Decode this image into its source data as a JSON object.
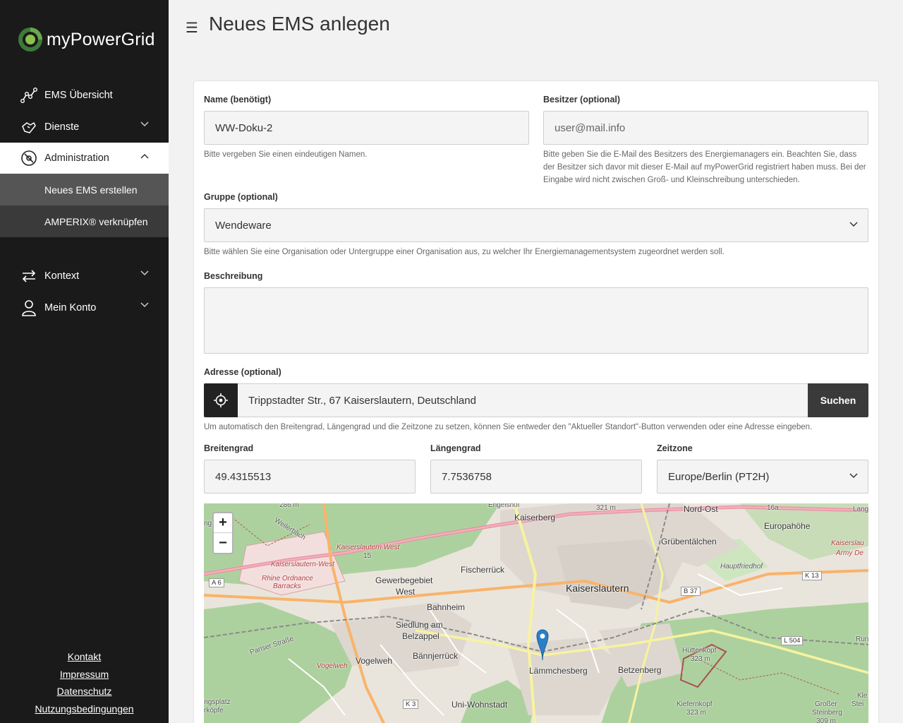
{
  "app": {
    "brand": "myPowerGrid",
    "page_title": "Neues EMS anlegen"
  },
  "sidebar": {
    "items": [
      {
        "label": "EMS Übersicht",
        "icon": "chart-line-icon"
      },
      {
        "label": "Dienste",
        "icon": "hand-service-icon"
      },
      {
        "label": "Administration",
        "icon": "compass-icon"
      }
    ],
    "subitems": [
      {
        "label": "Neues EMS erstellen"
      },
      {
        "label": "AMPERIX® verknüpfen"
      }
    ],
    "items2": [
      {
        "label": "Kontext",
        "icon": "arrows-swap-icon"
      },
      {
        "label": "Mein Konto",
        "icon": "user-icon"
      }
    ],
    "footer": [
      "Kontakt",
      "Impressum",
      "Datenschutz",
      "Nutzungsbedingungen"
    ]
  },
  "form": {
    "name": {
      "label": "Name (benötigt)",
      "value": "WW-Doku-2",
      "hint": "Bitte vergeben Sie einen eindeutigen Namen."
    },
    "owner": {
      "label": "Besitzer (optional)",
      "placeholder": "user@mail.info",
      "hint": "Bitte geben Sie die E-Mail des Besitzers des Energiemanagers ein. Beachten Sie, dass der Besitzer sich davor mit dieser E-Mail auf myPowerGrid registriert haben muss. Bei der Eingabe wird nicht zwischen Groß- und Kleinschreibung unterschieden."
    },
    "group": {
      "label": "Gruppe (optional)",
      "value": "Wendeware",
      "hint": "Bitte wählen Sie eine Organisation oder Untergruppe einer Organisation aus, zu welcher Ihr Energiemanagementsystem zugeordnet werden soll."
    },
    "description": {
      "label": "Beschreibung",
      "value": ""
    },
    "address": {
      "label": "Adresse (optional)",
      "value": "Trippstadter Str., 67 Kaiserslautern, Deutschland",
      "search_label": "Suchen",
      "hint": "Um automatisch den Breitengrad, Längengrad und die Zeitzone zu setzen, können Sie entweder den \"Aktueller Standort\"-Button verwenden oder eine Adresse eingeben."
    },
    "lat": {
      "label": "Breitengrad",
      "value": "49.4315513"
    },
    "lng": {
      "label": "Längengrad",
      "value": "7.7536758"
    },
    "tz": {
      "label": "Zeitzone",
      "value": "Europe/Berlin (PT2H)"
    }
  },
  "map": {
    "zoom_in": "+",
    "zoom_out": "−",
    "labels": {
      "kaiserslautern": "Kaiserslautern",
      "kaiserberg": "Kaiserberg",
      "fischerrueck": "Fischerrück",
      "gewerbe1": "Gewerbegebiet",
      "gewerbe2": "West",
      "bahnheim": "Bahnheim",
      "siedlung1": "Siedlung am",
      "siedlung2": "Belzappel",
      "baennjerrueck": "Bännjerrück",
      "vogelweh": "Vogelweh",
      "vogelweh_red": "Vogelweh",
      "laemmchesberg": "Lämmchesberg",
      "betzenberg": "Betzenberg",
      "uniwohnstadt": "Uni-Wohnstadt",
      "gruebentaelchen": "Grübentälchen",
      "europahoehe": "Europahöhe",
      "nordost": "Nord-Ost",
      "hauptfriedhof": "Hauptfriedhof",
      "kl_west": "Kaiserslautern West",
      "kl_west2": "Kaiserslautern-West",
      "rhine1": "Rhine Ordnance",
      "rhine2": "Barracks",
      "army1": "Kaiserslau",
      "army2": "Army De",
      "huettenkopf": "Hüttenkopf",
      "huettenkopf_m": "323 m",
      "kiefernkopf": "Kiefernkopf",
      "kiefernkopf_m": "323 m",
      "grosser": "Großer",
      "steinberg": "Steinberg",
      "steinberg_m": "309 m",
      "engelshof": "Engelshof",
      "elev321": "321 m",
      "elev286": "286 m",
      "weilerbach": "Weilerbach",
      "pariser": "Pariser Straße",
      "a6": "A 6",
      "b37": "B 37",
      "k13": "K 13",
      "l504": "L 504",
      "k3": "K 3",
      "r15": "15",
      "s16a": "16a",
      "sportplatz1": "ingsplatz",
      "sportplatz2": "rköpfe",
      "lang": "Lang",
      "run": "Run",
      "kle": "Kle",
      "stei": "Stei",
      "ng": "ng"
    }
  }
}
